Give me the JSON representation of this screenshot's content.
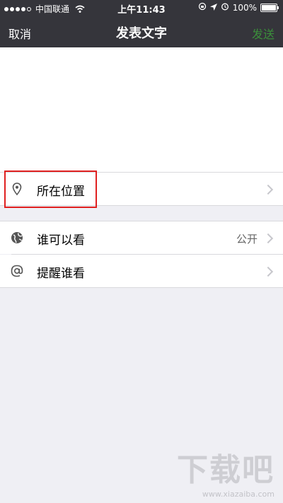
{
  "status_bar": {
    "signal_dots_filled": 4,
    "signal_dots_total": 5,
    "carrier": "中国联通",
    "wifi_icon": "wifi-icon",
    "time": "上午11:43",
    "icons": [
      "rotation-lock-icon",
      "location-arrow-icon",
      "alarm-icon"
    ],
    "battery_text": "100%",
    "battery_level": 1.0
  },
  "nav": {
    "cancel_label": "取消",
    "title": "发表文字",
    "send_label": "发送",
    "send_color": "#3b8f3b"
  },
  "location_row": {
    "icon": "location-pin-icon",
    "label": "所在位置"
  },
  "settings_rows": [
    {
      "icon": "globe-icon",
      "label": "谁可以看",
      "value": "公开"
    },
    {
      "icon": "at-icon",
      "label": "提醒谁看",
      "value": ""
    }
  ],
  "watermark": {
    "text": "下载吧",
    "url": "www.xiazaiba.com"
  },
  "colors": {
    "navbar_bg": "#35353b",
    "page_bg": "#efeff4",
    "highlight": "#e02020"
  }
}
